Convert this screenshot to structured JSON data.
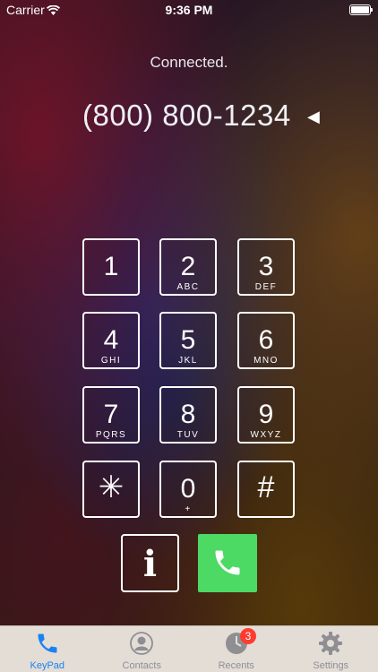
{
  "status_bar": {
    "carrier": "Carrier",
    "time": "9:36 PM"
  },
  "call": {
    "status": "Connected.",
    "number": "(800) 800-1234"
  },
  "keypad": {
    "keys": [
      {
        "digit": "1",
        "letters": ""
      },
      {
        "digit": "2",
        "letters": "ABC"
      },
      {
        "digit": "3",
        "letters": "DEF"
      },
      {
        "digit": "4",
        "letters": "GHI"
      },
      {
        "digit": "5",
        "letters": "JKL"
      },
      {
        "digit": "6",
        "letters": "MNO"
      },
      {
        "digit": "7",
        "letters": "PQRS"
      },
      {
        "digit": "8",
        "letters": "TUV"
      },
      {
        "digit": "9",
        "letters": "WXYZ"
      },
      {
        "digit": "✳",
        "letters": ""
      },
      {
        "digit": "0",
        "letters": "+"
      },
      {
        "digit": "#",
        "letters": ""
      }
    ]
  },
  "actions": {
    "info_icon": "info-icon",
    "call_icon": "phone-icon",
    "call_color": "#4cd964"
  },
  "tab_bar": {
    "tabs": [
      {
        "label": "KeyPad",
        "icon": "phone-icon",
        "active": true
      },
      {
        "label": "Contacts",
        "icon": "contact-icon",
        "active": false
      },
      {
        "label": "Recents",
        "icon": "clock-icon",
        "active": false,
        "badge": "3"
      },
      {
        "label": "Settings",
        "icon": "gear-icon",
        "active": false
      }
    ],
    "active_color": "#1a82f0",
    "inactive_color": "#8e8e93",
    "badge_color": "#ff3b30"
  }
}
